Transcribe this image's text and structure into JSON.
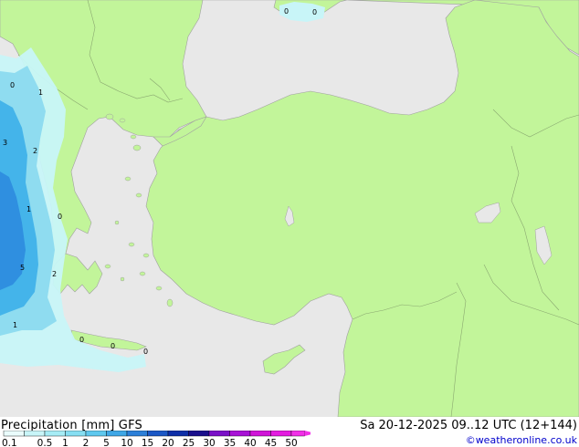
{
  "map": {
    "colors": {
      "sea": "#e8e8e8",
      "land": "#c2f59a",
      "precip_light": "#c8f5f8",
      "precip_medium": "#8fdcf0",
      "precip_heavy": "#44b4ea",
      "precip_very_heavy": "#2f8fe0",
      "coast": "#a0a0a0",
      "border": "#8aa870"
    },
    "point_values": [
      {
        "id": "v1",
        "text": "0"
      },
      {
        "id": "v2",
        "text": "0"
      },
      {
        "id": "v3",
        "text": "0"
      },
      {
        "id": "v4",
        "text": "1"
      },
      {
        "id": "v5",
        "text": "3"
      },
      {
        "id": "v6",
        "text": "2"
      },
      {
        "id": "v7",
        "text": "1"
      },
      {
        "id": "v8",
        "text": "0"
      },
      {
        "id": "v9",
        "text": "5"
      },
      {
        "id": "v10",
        "text": "2"
      },
      {
        "id": "v11",
        "text": "1"
      },
      {
        "id": "v12",
        "text": "0"
      },
      {
        "id": "v13",
        "text": "0"
      },
      {
        "id": "v14",
        "text": "0"
      }
    ]
  },
  "footer": {
    "title": "Precipitation [mm]  GFS",
    "datetime": "Sa 20-12-2025 09..12 UTC (12+144)",
    "credit": "©weatheronline.co.uk"
  },
  "legend": {
    "ticks": [
      "0.1",
      "0.5",
      "1",
      "2",
      "5",
      "10",
      "15",
      "20",
      "25",
      "30",
      "35",
      "40",
      "45",
      "50"
    ],
    "colors": [
      "#eafcfc",
      "#c8f5f8",
      "#a6ecf5",
      "#86def2",
      "#5ec8ee",
      "#3fa7e6",
      "#2c7fd8",
      "#1c58c6",
      "#0e2fa8",
      "#1a0f8c",
      "#7a10c8",
      "#a812d6",
      "#d014d8",
      "#e41ce0",
      "#f230e8"
    ]
  }
}
